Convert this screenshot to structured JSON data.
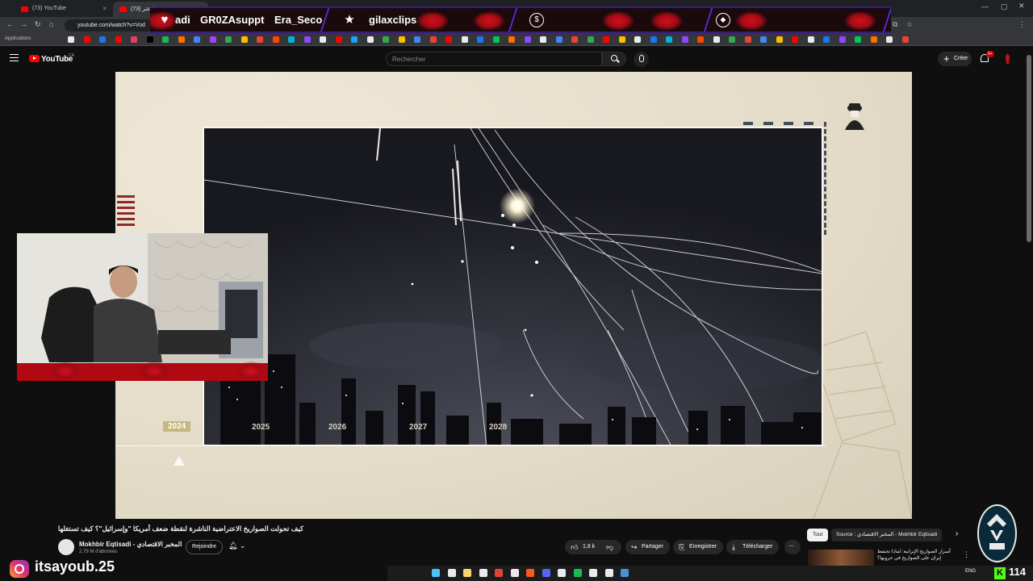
{
  "browser": {
    "tabs": [
      {
        "label": "(73) YouTube",
        "active": false
      },
      {
        "label": "(73) صواريخ الاعتر",
        "active": true
      }
    ],
    "url": "youtube.com/watch?v=Vod",
    "bookmarks_apps_label": "Applications"
  },
  "stream_banner": {
    "items": [
      {
        "icon": "heart-icon",
        "text": "adi"
      },
      {
        "icon": "",
        "text": "GR0ZAsuppt"
      },
      {
        "icon": "",
        "text": "Era_Seco"
      },
      {
        "icon": "star-icon",
        "text": "gilaxclips"
      },
      {
        "icon": "dollar-icon",
        "text": ""
      },
      {
        "icon": "diamond-icon",
        "text": ""
      }
    ]
  },
  "youtube_header": {
    "logo_text": "YouTube",
    "country_code": "CA",
    "search_placeholder": "Rechercher",
    "create_label": "Créer",
    "notification_badge": "9+"
  },
  "video": {
    "timeline_years": [
      "2024",
      "2025",
      "2026",
      "2027",
      "2028"
    ],
    "active_year": "2024"
  },
  "watch": {
    "title": "كيف تحولت الصواريخ الاعتراضية الناشرة لنقطة ضعف أمريكا \"وإسرائيل\"؟ كيف تستغلها إيران؟",
    "channel_name": "Mokhbir Eqtisadi - المخبر الاقتصادي",
    "channel_subs": "2,79 M d'abonnés",
    "join_label": "Rejoindre",
    "like_count": "1,8 k",
    "share_label": "Partager",
    "save_label": "Enregistrer",
    "download_label": "Télécharger"
  },
  "recommendations": {
    "chip_all": "Tout",
    "chip_source": "Source : المخبر الاقتصادي - Mokhbir Eqtisadi",
    "first_title": "أسرار الصواريخ الإيرانية: لماذا تحتفظ إيران على الصواريخ في حروبها؟"
  },
  "overlays": {
    "instagram_handle": "itsayoub.25",
    "viewer_count": "114",
    "taskbar_lang": "ENG"
  }
}
